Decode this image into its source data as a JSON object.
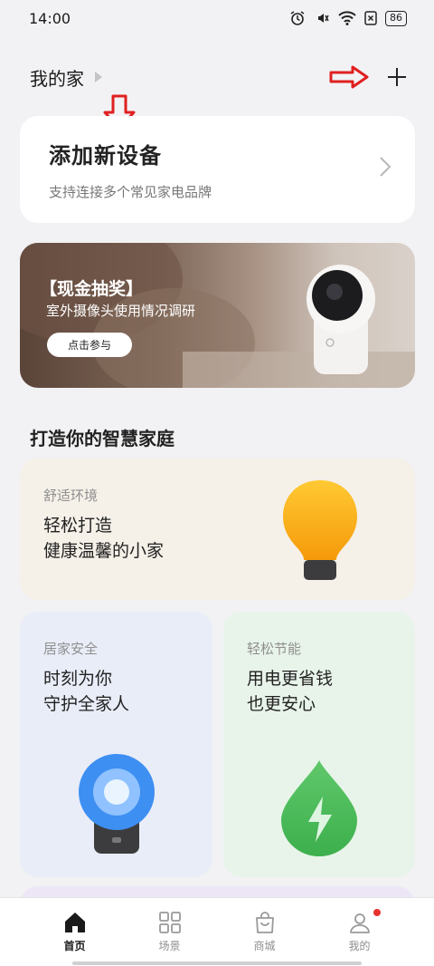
{
  "status": {
    "time": "14:00",
    "battery": "86"
  },
  "header": {
    "title": "我的家"
  },
  "add_card": {
    "title": "添加新设备",
    "subtitle": "支持连接多个常见家电品牌"
  },
  "banner": {
    "title": "【现金抽奖】",
    "subtitle": "室外摄像头使用情况调研",
    "button": "点击参与"
  },
  "section": {
    "title": "打造你的智慧家庭"
  },
  "tiles": [
    {
      "kicker": "舒适环境",
      "line1": "轻松打造",
      "line2": "健康温馨的小家",
      "icon": "lightbulb-icon"
    },
    {
      "kicker": "居家安全",
      "line1": "时刻为你",
      "line2": "守护全家人",
      "icon": "camera-icon"
    },
    {
      "kicker": "轻松节能",
      "line1": "用电更省钱",
      "line2": "也更安心",
      "icon": "energy-drop-icon"
    }
  ],
  "tabs": [
    {
      "label": "首页",
      "icon": "home-icon",
      "active": true
    },
    {
      "label": "场景",
      "icon": "grid-icon",
      "active": false
    },
    {
      "label": "商城",
      "icon": "bag-icon",
      "active": false
    },
    {
      "label": "我的",
      "icon": "user-icon",
      "active": false
    }
  ],
  "colors": {
    "annotation_arrow": "#e02020",
    "background": "#f2f2f4",
    "notification_dot": "#e8312f"
  }
}
